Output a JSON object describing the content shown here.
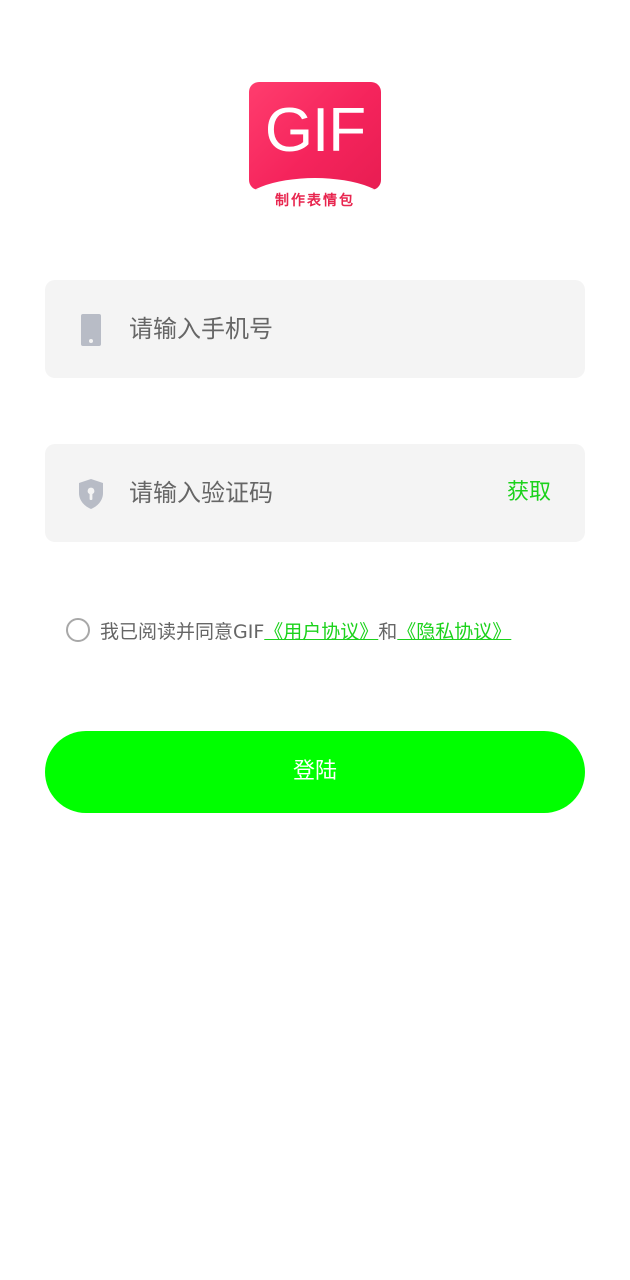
{
  "app": {
    "logo_text": "GIF",
    "logo_subtitle": "制作表情包"
  },
  "form": {
    "phone": {
      "placeholder": "请输入手机号",
      "value": "",
      "icon": "phone-icon"
    },
    "code": {
      "placeholder": "请输入验证码",
      "value": "",
      "icon": "shield-icon",
      "get_label": "获取"
    }
  },
  "agreement": {
    "checked": false,
    "prefix": "我已阅读并同意GIF",
    "user_agreement": "《用户协议》",
    "conjunction": "和",
    "privacy_agreement": "《隐私协议》"
  },
  "login": {
    "label": "登陆"
  },
  "colors": {
    "accent": "#00ff00",
    "link": "#1bd21b",
    "logo": "#f5245c",
    "field_bg": "#f4f4f4"
  }
}
